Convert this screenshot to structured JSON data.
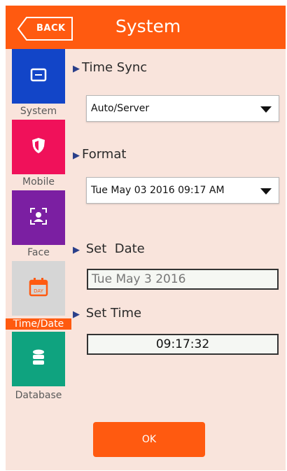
{
  "header": {
    "back_label": "BACK",
    "title": "System"
  },
  "colors": {
    "accent": "#ff5a10",
    "background": "#f9e4dc",
    "triangle": "#2a3f8a"
  },
  "sidebar": {
    "items": [
      {
        "label": "System",
        "icon": "window-icon",
        "color": "#1245c8",
        "active": false
      },
      {
        "label": "Mobile",
        "icon": "shield-icon",
        "color": "#f0115a",
        "active": false
      },
      {
        "label": "Face",
        "icon": "face-scan-icon",
        "color": "#7b1fa2",
        "active": false
      },
      {
        "label": "Time/Date",
        "icon": "calendar-icon",
        "color": "#d6d6d6",
        "active": true
      },
      {
        "label": "Database",
        "icon": "database-icon",
        "color": "#0fa37f",
        "active": false
      }
    ]
  },
  "time_sync": {
    "label": "Time Sync",
    "value": "Auto/Server"
  },
  "format": {
    "label": "Format",
    "value": "Tue May 03 2016 09:17 AM"
  },
  "set_date": {
    "label": "Set  Date",
    "value": "Tue May 3 2016"
  },
  "set_time": {
    "label": "Set Time",
    "value": "09:17:32"
  },
  "ok_label": "OK"
}
